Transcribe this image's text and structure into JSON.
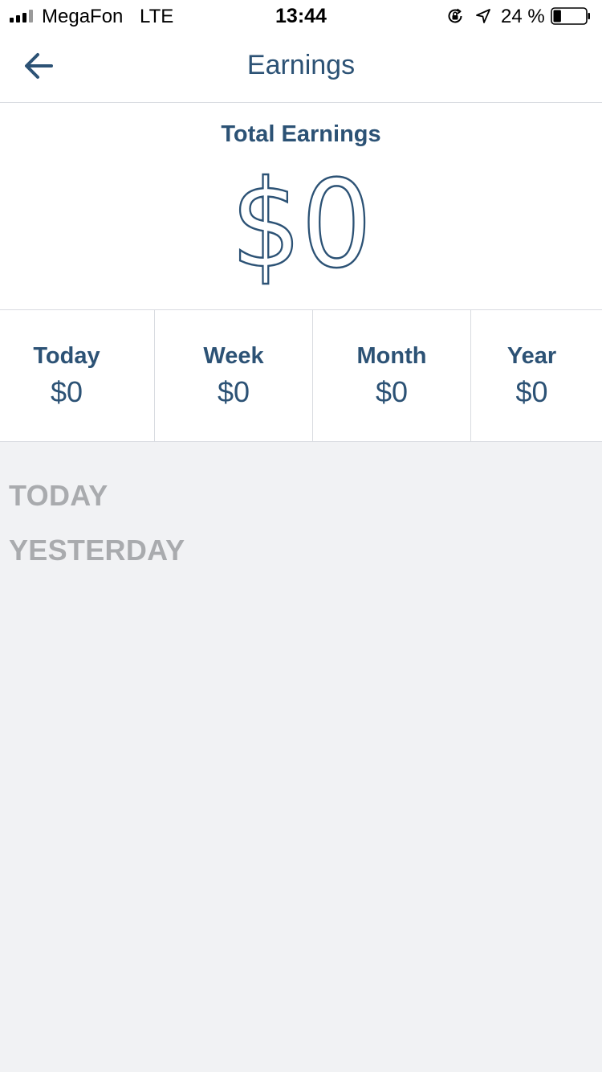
{
  "status_bar": {
    "carrier": "MegaFon",
    "network": "LTE",
    "time": "13:44",
    "battery_percent": "24 %",
    "battery_level": 0.24,
    "signal_bars": 3,
    "signal_bars_max": 4,
    "icons": [
      "signal-icon",
      "orientation-lock-icon",
      "location-arrow-icon",
      "battery-icon"
    ]
  },
  "header": {
    "title": "Earnings",
    "back_icon": "back-arrow-icon"
  },
  "total": {
    "label": "Total Earnings",
    "amount": "$0"
  },
  "periods": [
    {
      "label": "Today",
      "value": "$0"
    },
    {
      "label": "Week",
      "value": "$0"
    },
    {
      "label": "Month",
      "value": "$0"
    },
    {
      "label": "Year",
      "value": "$0"
    }
  ],
  "history": {
    "sections": [
      "TODAY",
      "YESTERDAY"
    ]
  },
  "colors": {
    "primary": "#2c5275",
    "muted_heading": "#a9abae",
    "background": "#f1f2f4",
    "surface": "#ffffff",
    "divider": "#d8dbe0"
  }
}
